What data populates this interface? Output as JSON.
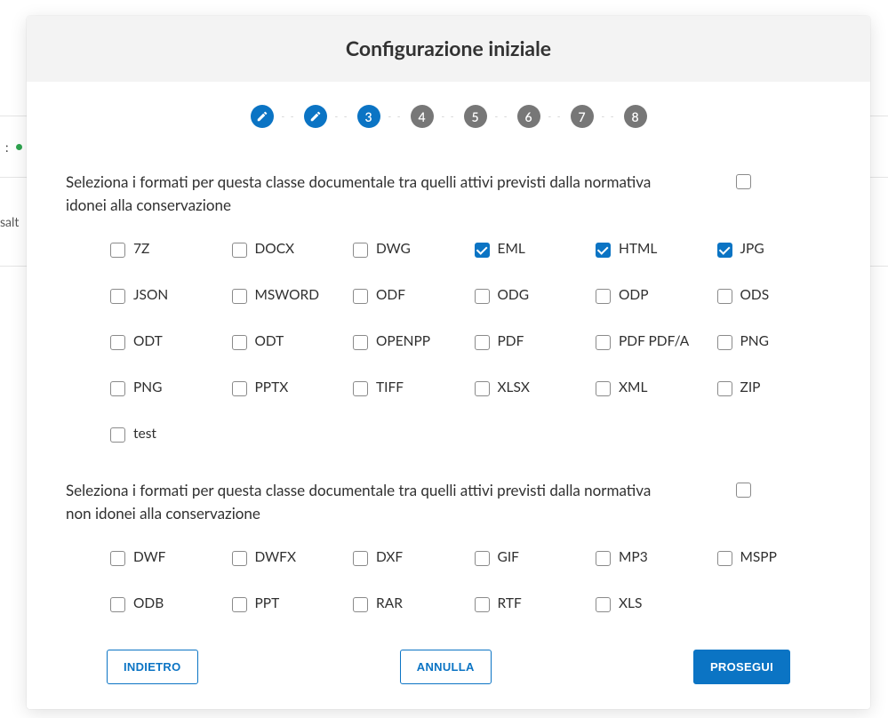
{
  "backdrop": {
    "status_label_fragment": ":",
    "row2_fragment": "salt"
  },
  "modal": {
    "title": "Configurazione iniziale"
  },
  "stepper": {
    "steps": [
      {
        "kind": "done",
        "label": ""
      },
      {
        "kind": "done",
        "label": ""
      },
      {
        "kind": "current",
        "label": "3"
      },
      {
        "kind": "future",
        "label": "4"
      },
      {
        "kind": "future",
        "label": "5"
      },
      {
        "kind": "future",
        "label": "6"
      },
      {
        "kind": "future",
        "label": "7"
      },
      {
        "kind": "future",
        "label": "8"
      }
    ]
  },
  "sections": [
    {
      "heading": "Seleziona i formati per questa classe documentale tra quelli attivi previsti dalla normativa idonei alla conservazione",
      "master_checked": false,
      "items": [
        {
          "label": "7Z",
          "checked": false
        },
        {
          "label": "DOCX",
          "checked": false
        },
        {
          "label": "DWG",
          "checked": false
        },
        {
          "label": "EML",
          "checked": true
        },
        {
          "label": "HTML",
          "checked": true
        },
        {
          "label": "JPG",
          "checked": true
        },
        {
          "label": "JSON",
          "checked": false
        },
        {
          "label": "MSWORD",
          "checked": false
        },
        {
          "label": "ODF",
          "checked": false
        },
        {
          "label": "ODG",
          "checked": false
        },
        {
          "label": "ODP",
          "checked": false
        },
        {
          "label": "ODS",
          "checked": false
        },
        {
          "label": "ODT",
          "checked": false
        },
        {
          "label": "ODT",
          "checked": false
        },
        {
          "label": "OPENPP",
          "checked": false
        },
        {
          "label": "PDF",
          "checked": false
        },
        {
          "label": "PDF PDF/A",
          "checked": false
        },
        {
          "label": "PNG",
          "checked": false
        },
        {
          "label": "PNG",
          "checked": false
        },
        {
          "label": "PPTX",
          "checked": false
        },
        {
          "label": "TIFF",
          "checked": false
        },
        {
          "label": "XLSX",
          "checked": false
        },
        {
          "label": "XML",
          "checked": false
        },
        {
          "label": "ZIP",
          "checked": false
        },
        {
          "label": "test",
          "checked": false
        }
      ]
    },
    {
      "heading": "Seleziona i formati per questa classe documentale tra quelli attivi previsti dalla normativa non idonei alla conservazione",
      "master_checked": false,
      "items": [
        {
          "label": "DWF",
          "checked": false
        },
        {
          "label": "DWFX",
          "checked": false
        },
        {
          "label": "DXF",
          "checked": false
        },
        {
          "label": "GIF",
          "checked": false
        },
        {
          "label": "MP3",
          "checked": false
        },
        {
          "label": "MSPP",
          "checked": false
        },
        {
          "label": "ODB",
          "checked": false
        },
        {
          "label": "PPT",
          "checked": false
        },
        {
          "label": "RAR",
          "checked": false
        },
        {
          "label": "RTF",
          "checked": false
        },
        {
          "label": "XLS",
          "checked": false
        }
      ]
    }
  ],
  "footer": {
    "back": "INDIETRO",
    "cancel": "ANNULLA",
    "next": "PROSEGUI"
  }
}
